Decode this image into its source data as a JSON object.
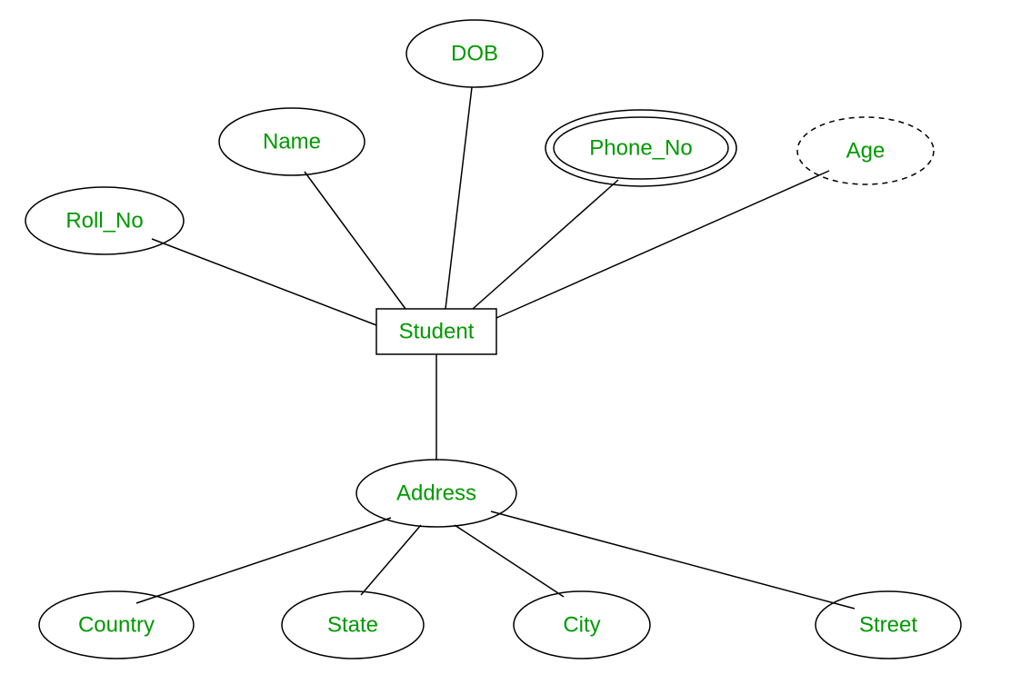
{
  "entity": {
    "label": "Student"
  },
  "attributes": {
    "roll_no": {
      "label": "Roll_No"
    },
    "name": {
      "label": "Name"
    },
    "dob": {
      "label": "DOB"
    },
    "phone_no": {
      "label": "Phone_No"
    },
    "age": {
      "label": "Age"
    },
    "address": {
      "label": "Address"
    }
  },
  "address_subattributes": {
    "country": {
      "label": "Country"
    },
    "state": {
      "label": "State"
    },
    "city": {
      "label": "City"
    },
    "street": {
      "label": "Street"
    }
  }
}
